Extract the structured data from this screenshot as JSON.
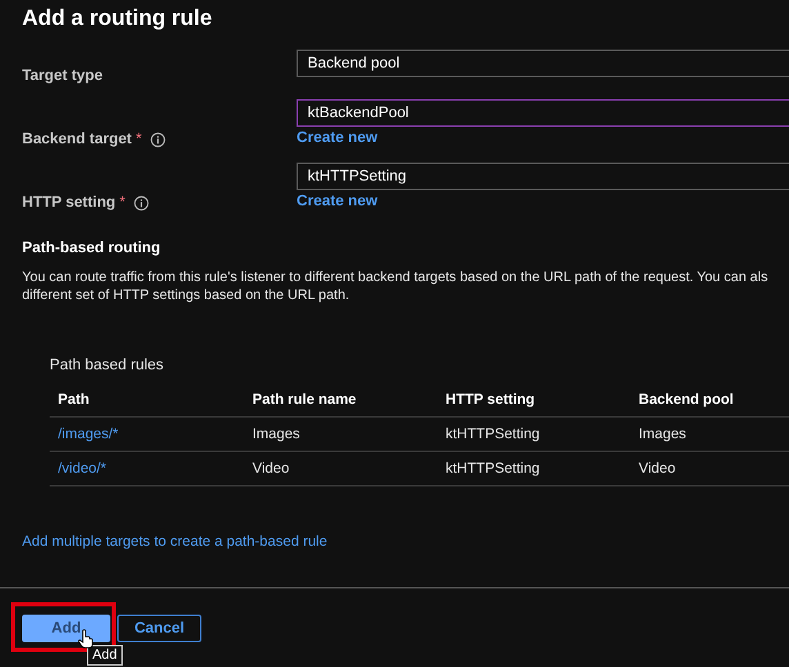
{
  "title": "Add a routing rule",
  "fields": [
    {
      "label": "Target type",
      "info": false,
      "value": "Backend pool",
      "focused": false
    },
    {
      "label": "Backend target",
      "required_mark": "*",
      "info": true,
      "value": "ktBackendPool",
      "focused": true,
      "link": "Create new"
    },
    {
      "label": "HTTP setting",
      "required_mark": "*",
      "info": true,
      "value": "ktHTTPSetting",
      "focused": false,
      "link": "Create new"
    }
  ],
  "section": {
    "heading": "Path-based routing",
    "description": [
      "You can route traffic from this rule's listener to different backend targets based on the URL path of the request. You can als",
      "different set of HTTP settings based on the URL path."
    ]
  },
  "table": {
    "title": "Path based rules",
    "columns": [
      "Path",
      "Path rule name",
      "HTTP setting",
      "Backend pool"
    ],
    "rows": [
      [
        "/images/*",
        "Images",
        "ktHTTPSetting",
        "Images"
      ],
      [
        "/video/*",
        "Video",
        "ktHTTPSetting",
        "Video"
      ]
    ]
  },
  "add_targets_link": "Add multiple targets to create a path-based rule",
  "buttons": [
    {
      "label": "Add",
      "kind": "primary",
      "highlighted": true,
      "tooltip": "Add"
    },
    {
      "label": "Cancel",
      "kind": "secondary",
      "highlighted": false
    }
  ]
}
